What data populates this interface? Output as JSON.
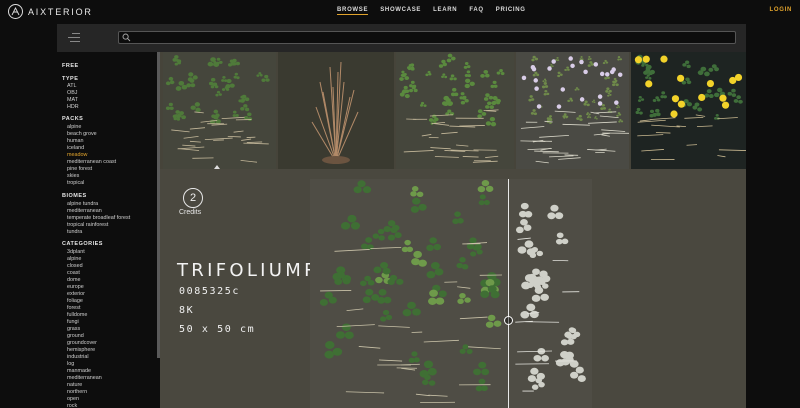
{
  "brand": {
    "name": "AIXTERIOR"
  },
  "nav": {
    "links": [
      "BROWSE",
      "SHOWCASE",
      "LEARN",
      "FAQ",
      "PRICING"
    ],
    "login": "LOGIN"
  },
  "search": {
    "placeholder": ""
  },
  "sidebar": {
    "free": "FREE",
    "type_heading": "TYPE",
    "types": [
      "ATL",
      "OBJ",
      "MAT",
      "HDR"
    ],
    "packs_heading": "PACKS",
    "packs": [
      "alpine",
      "beach grove",
      "human",
      "iceland",
      "meadow",
      "mediterranean coast",
      "pine forest",
      "skies",
      "tropical"
    ],
    "selected_pack": "meadow",
    "biomes_heading": "BIOMES",
    "biomes": [
      "alpine tundra",
      "mediterranean",
      "temperate broadleaf forest",
      "tropical rainforest",
      "tundra"
    ],
    "categories_heading": "CATEGORIES",
    "categories": [
      "3dplant",
      "alpine",
      "closed",
      "coast",
      "dome",
      "europe",
      "exterior",
      "foliage",
      "forest",
      "fulldome",
      "fungi",
      "grass",
      "ground",
      "groundcover",
      "hemisphere",
      "industrial",
      "log",
      "manmade",
      "mediterranean",
      "nature",
      "northern",
      "open",
      "rock"
    ]
  },
  "detail": {
    "credits_value": "2",
    "credits_label": "Credits",
    "title": "TRIFOLIUMREPENS",
    "id": "0085325c",
    "resolution": "8K",
    "size": "50 x 50 cm"
  },
  "colors": {
    "accent": "#e1a32c",
    "panel": "#4a483f",
    "background": "#0d0d0d"
  }
}
